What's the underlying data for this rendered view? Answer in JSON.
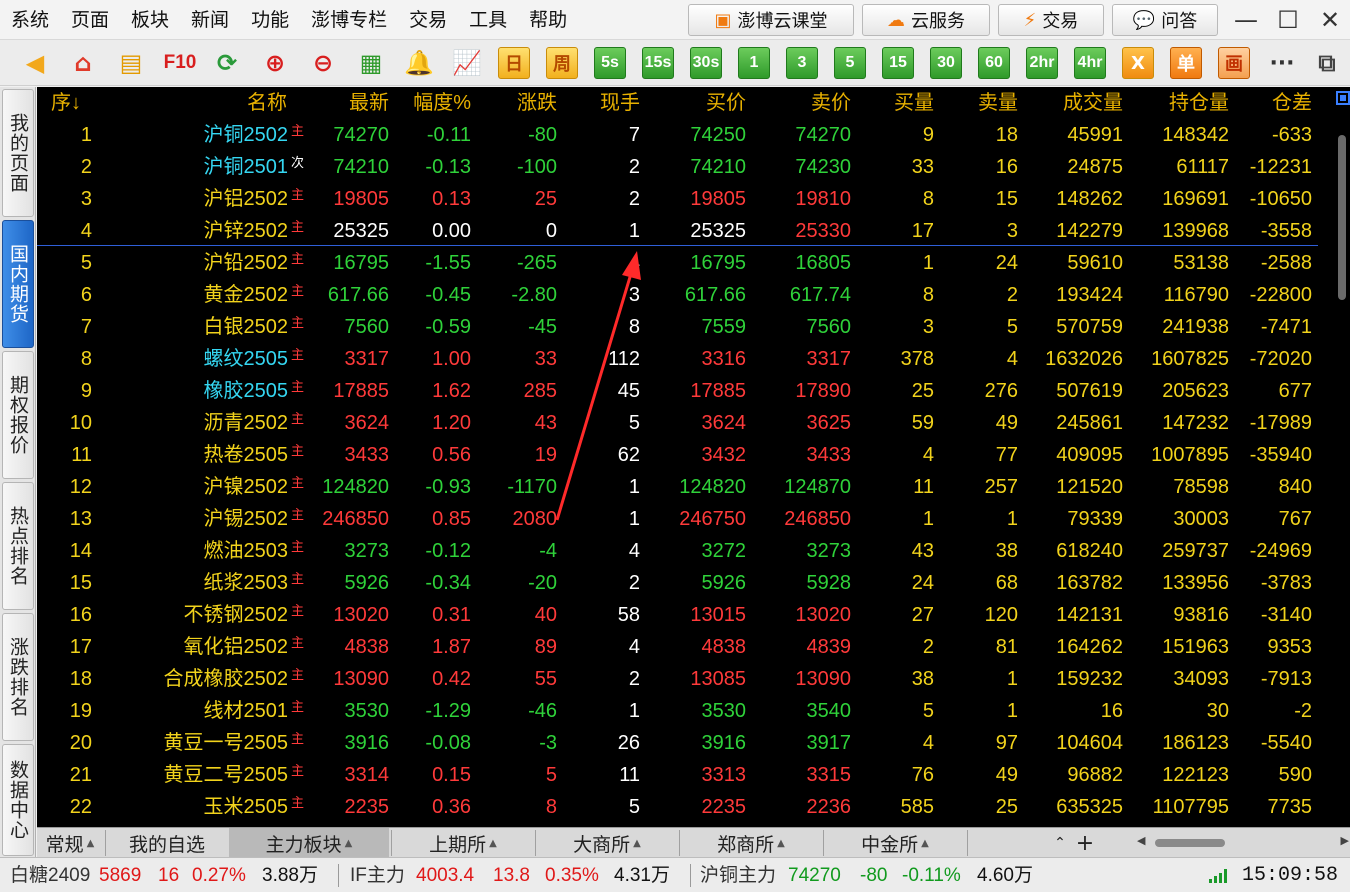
{
  "menu": {
    "items": [
      "系统",
      "页面",
      "板块",
      "新闻",
      "功能",
      "澎博专栏",
      "交易",
      "工具",
      "帮助"
    ]
  },
  "promo_buttons": {
    "cloud_class": "澎博云课堂",
    "cloud_service": "云服务",
    "trade": "交易",
    "qa": "问答"
  },
  "toolbar": {
    "f10": "F10",
    "day": "日",
    "week": "周",
    "periods": [
      "5s",
      "15s",
      "30s",
      "1",
      "3",
      "5",
      "15",
      "30",
      "60",
      "2hr",
      "4hr"
    ],
    "x": "X",
    "single": "单",
    "draw": "画",
    "more": "···"
  },
  "left_tabs": [
    "我的页面",
    "国内期货",
    "期权报价",
    "热点排名",
    "涨跌排名",
    "数据中心"
  ],
  "table": {
    "headers": [
      "序",
      "名称",
      "最新",
      "幅度%",
      "涨跌",
      "现手",
      "买价",
      "卖价",
      "买量",
      "卖量",
      "成交量",
      "持仓量",
      "仓差"
    ],
    "sort_arrow": "↓",
    "rows": [
      {
        "no": "1",
        "name": "沪铜2502",
        "tag": "主",
        "last": "74270",
        "pct": "-0.11",
        "chg": "-80",
        "hand": "7",
        "bid": "74250",
        "ask": "74270",
        "bidv": "9",
        "askv": "18",
        "vol": "45991",
        "oi": "148342",
        "oid": "-633",
        "dir": "dn",
        "namecolor": "cy"
      },
      {
        "no": "2",
        "name": "沪铜2501",
        "tag": "次",
        "last": "74210",
        "pct": "-0.13",
        "chg": "-100",
        "hand": "2",
        "bid": "74210",
        "ask": "74230",
        "bidv": "33",
        "askv": "16",
        "vol": "24875",
        "oi": "61117",
        "oid": "-12231",
        "dir": "dn",
        "namecolor": "cy"
      },
      {
        "no": "3",
        "name": "沪铝2502",
        "tag": "主",
        "last": "19805",
        "pct": "0.13",
        "chg": "25",
        "hand": "2",
        "bid": "19805",
        "ask": "19810",
        "bidv": "8",
        "askv": "15",
        "vol": "148262",
        "oi": "169691",
        "oid": "-10650",
        "dir": "up",
        "namecolor": "yl"
      },
      {
        "no": "4",
        "name": "沪锌2502",
        "tag": "主",
        "last": "25325",
        "pct": "0.00",
        "chg": "0",
        "hand": "1",
        "bid": "25325",
        "ask": "25330",
        "bidv": "17",
        "askv": "3",
        "vol": "142279",
        "oi": "139968",
        "oid": "-3558",
        "dir": "eq",
        "namecolor": "yl"
      },
      {
        "no": "5",
        "name": "沪铅2502",
        "tag": "主",
        "last": "16795",
        "pct": "-1.55",
        "chg": "-265",
        "hand": "4",
        "bid": "16795",
        "ask": "16805",
        "bidv": "1",
        "askv": "24",
        "vol": "59610",
        "oi": "53138",
        "oid": "-2588",
        "dir": "dn",
        "namecolor": "yl"
      },
      {
        "no": "6",
        "name": "黄金2502",
        "tag": "主",
        "last": "617.66",
        "pct": "-0.45",
        "chg": "-2.80",
        "hand": "3",
        "bid": "617.66",
        "ask": "617.74",
        "bidv": "8",
        "askv": "2",
        "vol": "193424",
        "oi": "116790",
        "oid": "-22800",
        "dir": "dn",
        "namecolor": "yl"
      },
      {
        "no": "7",
        "name": "白银2502",
        "tag": "主",
        "last": "7560",
        "pct": "-0.59",
        "chg": "-45",
        "hand": "8",
        "bid": "7559",
        "ask": "7560",
        "bidv": "3",
        "askv": "5",
        "vol": "570759",
        "oi": "241938",
        "oid": "-7471",
        "dir": "dn",
        "namecolor": "yl"
      },
      {
        "no": "8",
        "name": "螺纹2505",
        "tag": "主",
        "last": "3317",
        "pct": "1.00",
        "chg": "33",
        "hand": "112",
        "bid": "3316",
        "ask": "3317",
        "bidv": "378",
        "askv": "4",
        "vol": "1632026",
        "oi": "1607825",
        "oid": "-72020",
        "dir": "up",
        "namecolor": "cy"
      },
      {
        "no": "9",
        "name": "橡胶2505",
        "tag": "主",
        "last": "17885",
        "pct": "1.62",
        "chg": "285",
        "hand": "45",
        "bid": "17885",
        "ask": "17890",
        "bidv": "25",
        "askv": "276",
        "vol": "507619",
        "oi": "205623",
        "oid": "677",
        "dir": "up",
        "namecolor": "cy"
      },
      {
        "no": "10",
        "name": "沥青2502",
        "tag": "主",
        "last": "3624",
        "pct": "1.20",
        "chg": "43",
        "hand": "5",
        "bid": "3624",
        "ask": "3625",
        "bidv": "59",
        "askv": "49",
        "vol": "245861",
        "oi": "147232",
        "oid": "-17989",
        "dir": "up",
        "namecolor": "yl"
      },
      {
        "no": "11",
        "name": "热卷2505",
        "tag": "主",
        "last": "3433",
        "pct": "0.56",
        "chg": "19",
        "hand": "62",
        "bid": "3432",
        "ask": "3433",
        "bidv": "4",
        "askv": "77",
        "vol": "409095",
        "oi": "1007895",
        "oid": "-35940",
        "dir": "up",
        "namecolor": "yl"
      },
      {
        "no": "12",
        "name": "沪镍2502",
        "tag": "主",
        "last": "124820",
        "pct": "-0.93",
        "chg": "-1170",
        "hand": "1",
        "bid": "124820",
        "ask": "124870",
        "bidv": "11",
        "askv": "257",
        "vol": "121520",
        "oi": "78598",
        "oid": "840",
        "dir": "dn",
        "namecolor": "yl"
      },
      {
        "no": "13",
        "name": "沪锡2502",
        "tag": "主",
        "last": "246850",
        "pct": "0.85",
        "chg": "2080",
        "hand": "1",
        "bid": "246750",
        "ask": "246850",
        "bidv": "1",
        "askv": "1",
        "vol": "79339",
        "oi": "30003",
        "oid": "767",
        "dir": "up",
        "namecolor": "yl"
      },
      {
        "no": "14",
        "name": "燃油2503",
        "tag": "主",
        "last": "3273",
        "pct": "-0.12",
        "chg": "-4",
        "hand": "4",
        "bid": "3272",
        "ask": "3273",
        "bidv": "43",
        "askv": "38",
        "vol": "618240",
        "oi": "259737",
        "oid": "-24969",
        "dir": "dn",
        "namecolor": "yl"
      },
      {
        "no": "15",
        "name": "纸浆2503",
        "tag": "主",
        "last": "5926",
        "pct": "-0.34",
        "chg": "-20",
        "hand": "2",
        "bid": "5926",
        "ask": "5928",
        "bidv": "24",
        "askv": "68",
        "vol": "163782",
        "oi": "133956",
        "oid": "-3783",
        "dir": "dn",
        "namecolor": "yl"
      },
      {
        "no": "16",
        "name": "不锈钢2502",
        "tag": "主",
        "last": "13020",
        "pct": "0.31",
        "chg": "40",
        "hand": "58",
        "bid": "13015",
        "ask": "13020",
        "bidv": "27",
        "askv": "120",
        "vol": "142131",
        "oi": "93816",
        "oid": "-3140",
        "dir": "up",
        "namecolor": "yl"
      },
      {
        "no": "17",
        "name": "氧化铝2502",
        "tag": "主",
        "last": "4838",
        "pct": "1.87",
        "chg": "89",
        "hand": "4",
        "bid": "4838",
        "ask": "4839",
        "bidv": "2",
        "askv": "81",
        "vol": "164262",
        "oi": "151963",
        "oid": "9353",
        "dir": "up",
        "namecolor": "yl"
      },
      {
        "no": "18",
        "name": "合成橡胶2502",
        "tag": "主",
        "last": "13090",
        "pct": "0.42",
        "chg": "55",
        "hand": "2",
        "bid": "13085",
        "ask": "13090",
        "bidv": "38",
        "askv": "1",
        "vol": "159232",
        "oi": "34093",
        "oid": "-7913",
        "dir": "up",
        "namecolor": "yl"
      },
      {
        "no": "19",
        "name": "线材2501",
        "tag": "主",
        "last": "3530",
        "pct": "-1.29",
        "chg": "-46",
        "hand": "1",
        "bid": "3530",
        "ask": "3540",
        "bidv": "5",
        "askv": "1",
        "vol": "16",
        "oi": "30",
        "oid": "-2",
        "dir": "dn",
        "namecolor": "yl"
      },
      {
        "no": "20",
        "name": "黄豆一号2505",
        "tag": "主",
        "last": "3916",
        "pct": "-0.08",
        "chg": "-3",
        "hand": "26",
        "bid": "3916",
        "ask": "3917",
        "bidv": "4",
        "askv": "97",
        "vol": "104604",
        "oi": "186123",
        "oid": "-5540",
        "dir": "dn",
        "namecolor": "yl"
      },
      {
        "no": "21",
        "name": "黄豆二号2505",
        "tag": "主",
        "last": "3314",
        "pct": "0.15",
        "chg": "5",
        "hand": "11",
        "bid": "3313",
        "ask": "3315",
        "bidv": "76",
        "askv": "49",
        "vol": "96882",
        "oi": "122123",
        "oid": "590",
        "dir": "up",
        "namecolor": "yl"
      },
      {
        "no": "22",
        "name": "玉米2505",
        "tag": "主",
        "last": "2235",
        "pct": "0.36",
        "chg": "8",
        "hand": "5",
        "bid": "2235",
        "ask": "2236",
        "bidv": "585",
        "askv": "25",
        "vol": "635325",
        "oi": "1107795",
        "oid": "7735",
        "dir": "up",
        "namecolor": "yl"
      }
    ]
  },
  "bottom_tabs": [
    "常规",
    "我的自选",
    "主力板块",
    "上期所",
    "大商所",
    "郑商所",
    "中金所"
  ],
  "status": {
    "t1": {
      "name": "白糖2409",
      "last": "5869",
      "chg": "16",
      "pct": "0.27%",
      "vol": "3.88万"
    },
    "t2": {
      "name": "IF主力",
      "last": "4003.4",
      "chg": "13.8",
      "pct": "0.35%",
      "vol": "4.31万"
    },
    "t3": {
      "name": "沪铜主力",
      "last": "74270",
      "chg": "-80",
      "pct": "-0.11%",
      "vol": "4.60万"
    },
    "clock": "15:09:58"
  },
  "colors": {
    "up": "#ff3a3a",
    "down": "#2fd23a",
    "header": "#e8b100",
    "accent": "#1e66c6"
  }
}
